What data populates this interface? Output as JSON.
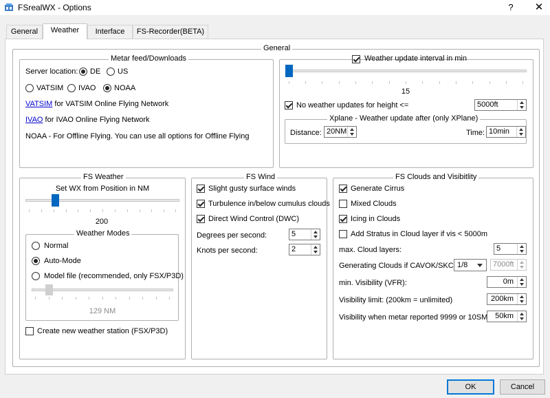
{
  "window": {
    "title": "FSrealWX - Options",
    "help_glyph": "?",
    "close_glyph": "✕",
    "icon": "fsrealwx-app-icon"
  },
  "tabs": [
    {
      "label": "General",
      "active": false
    },
    {
      "label": "Weather",
      "active": true
    },
    {
      "label": "Interface",
      "active": false
    },
    {
      "label": "FS-Recorder(BETA)",
      "active": false
    }
  ],
  "general_group": {
    "title": "General"
  },
  "metar": {
    "title": "Metar feed/Downloads",
    "server_label": "Server location:",
    "server_options": [
      {
        "label": "DE",
        "checked": true
      },
      {
        "label": "US",
        "checked": false
      }
    ],
    "network_options": [
      {
        "label": "VATSIM",
        "checked": false
      },
      {
        "label": "IVAO",
        "checked": false
      },
      {
        "label": "NOAA",
        "checked": true
      }
    ],
    "vatsim_link": "VATSIM",
    "vatsim_desc": "for VATSIM Online Flying Network",
    "ivao_link": "IVAO",
    "ivao_desc": "for IVAO Online Flying Network",
    "noaa_desc": "NOAA - For Offline Flying. You can use all options for Offline Flying"
  },
  "update_interval": {
    "label": "Weather update interval in min",
    "checked": true,
    "slider_value": 15,
    "slider_fraction": 0.0,
    "value_text": "15",
    "no_updates_label": "No weather updates for height <=",
    "no_updates_checked": true,
    "height_value": "5000ft"
  },
  "xplane": {
    "title": "Xplane - Weather update after (only XPlane)",
    "distance_label": "Distance:",
    "distance_value": "20NM",
    "time_label": "Time:",
    "time_value": "10min"
  },
  "fs_weather": {
    "title": "FS Weather",
    "set_wx_label": "Set WX from Position in NM",
    "slider_fraction": 0.18,
    "value_text": "200",
    "modes_title": "Weather Modes",
    "modes": [
      {
        "label": "Normal",
        "checked": false
      },
      {
        "label": "Auto-Mode",
        "checked": true
      },
      {
        "label": "Model file (recommended, only FSX/P3D)",
        "checked": false
      }
    ],
    "model_slider_fraction": 0.1,
    "model_value_text": "129 NM",
    "create_station_label": "Create new weather station (FSX/P3D)",
    "create_station_checked": false
  },
  "fs_wind": {
    "title": "FS Wind",
    "options": [
      {
        "label": "Slight gusty surface winds",
        "checked": true
      },
      {
        "label": "Turbulence in/below cumulus clouds",
        "checked": true
      },
      {
        "label": "Direct Wind Control (DWC)",
        "checked": true
      }
    ],
    "degrees_label": "Degrees per second:",
    "degrees_value": "5",
    "knots_label": "Knots per second:",
    "knots_value": "2"
  },
  "fs_clouds": {
    "title": "FS Clouds and Visibitlity",
    "options": [
      {
        "label": "Generate Cirrus",
        "checked": true
      },
      {
        "label": "Mixed Clouds",
        "checked": false
      },
      {
        "label": "Icing in Clouds",
        "checked": true
      },
      {
        "label": "Add Stratus in Cloud layer if vis < 5000m",
        "checked": false
      }
    ],
    "max_layers_label": "max. Cloud layers:",
    "max_layers_value": "5",
    "cavok_label": "Generating Clouds if CAVOK/SKC:",
    "cavok_combo": "1/8",
    "cavok_height": "7000ft",
    "min_vis_label": "min. Visibility (VFR):",
    "min_vis_value": "0m",
    "vis_limit_label": "Visibility limit: (200km = unlimited)",
    "vis_limit_value": "200km",
    "vis_9999_label": "Visibility when metar reported 9999 or 10SM:",
    "vis_9999_value": "50km"
  },
  "buttons": {
    "ok": "OK",
    "cancel": "Cancel"
  }
}
